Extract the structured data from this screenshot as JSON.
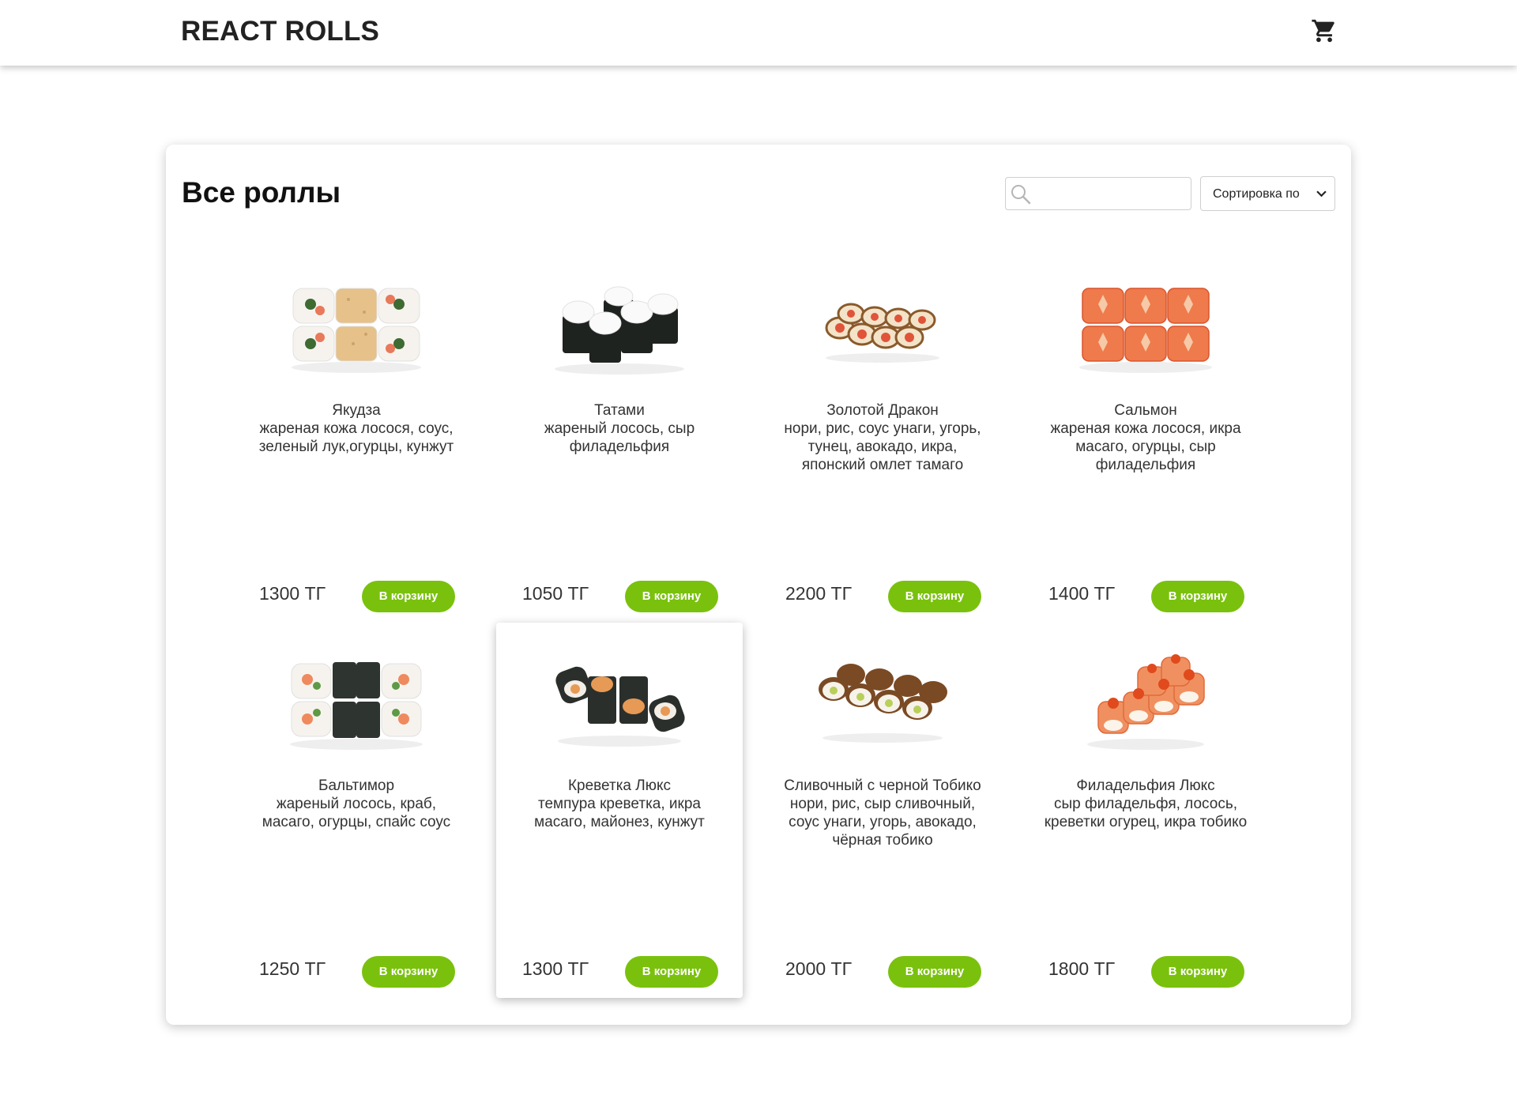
{
  "header": {
    "brand": "REACT ROLLS",
    "cart_icon": "shopping-cart-icon"
  },
  "catalog": {
    "title": "Все роллы",
    "search": {
      "value": "",
      "placeholder": "",
      "icon": "search-icon"
    },
    "sort": {
      "selected": "Сортировка по"
    },
    "accent_color": "#7ac10d",
    "items": [
      {
        "name": "Якудза",
        "desc": "жареная кожа лосося, соус, зеленый лук,огурцы, кунжут",
        "price": "1300 ТГ",
        "button": "В корзину"
      },
      {
        "name": "Татами",
        "desc": "жареный лосось, сыр филадельфия",
        "price": "1050 ТГ",
        "button": "В корзину"
      },
      {
        "name": "Золотой Дракон",
        "desc": "нори, рис, соус унаги, угорь, тунец, авокадо, икра, японский омлет тамаго",
        "price": "2200 ТГ",
        "button": "В корзину"
      },
      {
        "name": "Сальмон",
        "desc": "жареная кожа лосося, икра масаго, огурцы, сыр филадельфия",
        "price": "1400 ТГ",
        "button": "В корзину"
      },
      {
        "name": "Бальтимор",
        "desc": "жареный лосось, краб, масаго, огурцы, спайс соус",
        "price": "1250 ТГ",
        "button": "В корзину"
      },
      {
        "name": "Креветка Люкс",
        "desc": "темпура креветка, икра масаго, майонез, кунжут",
        "price": "1300 ТГ",
        "button": "В корзину"
      },
      {
        "name": "Сливочный с черной Тобико",
        "desc": "нори, рис, сыр сливочный, соус унаги, угорь, авокадо, чёрная тобико",
        "price": "2000 ТГ",
        "button": "В корзину"
      },
      {
        "name": "Филадельфия Люкс",
        "desc": "сыр филадельфя, лосось, креветки огурец, икра тобико",
        "price": "1800 ТГ",
        "button": "В корзину"
      }
    ]
  }
}
